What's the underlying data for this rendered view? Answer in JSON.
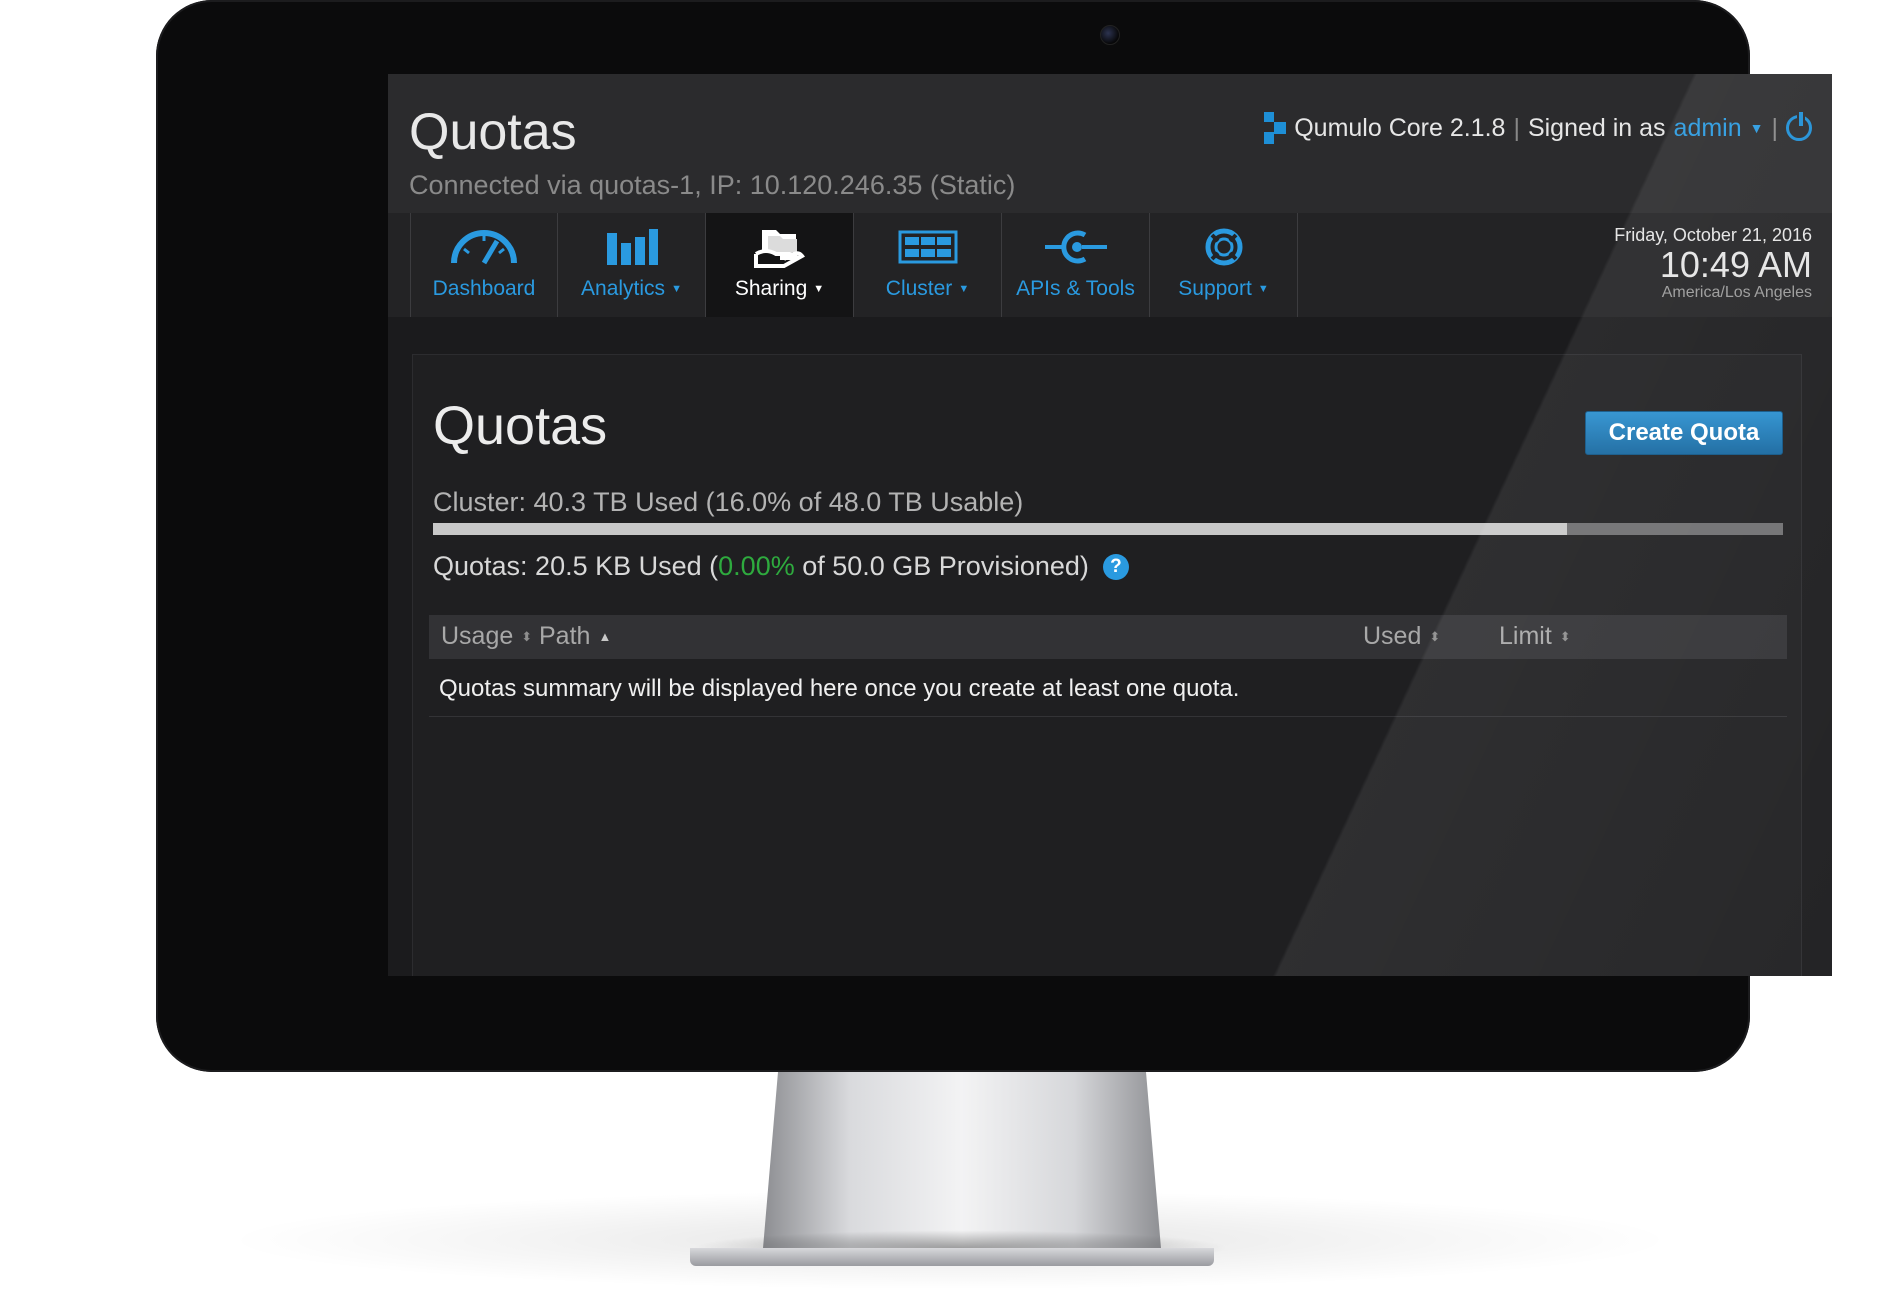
{
  "app": {
    "page_title": "Quotas",
    "connection": "Connected via quotas-1, IP: 10.120.246.35 (Static)",
    "product": "Qumulo Core 2.1.8",
    "signed_in_label": "Signed in as",
    "user": "admin",
    "separator": "|"
  },
  "nav": {
    "items": [
      {
        "label": "Dashboard",
        "icon": "speedometer-icon",
        "dropdown": false,
        "active": false
      },
      {
        "label": "Analytics",
        "icon": "bar-chart-icon",
        "dropdown": true,
        "active": false
      },
      {
        "label": "Sharing",
        "icon": "folders-hand-icon",
        "dropdown": true,
        "active": true
      },
      {
        "label": "Cluster",
        "icon": "server-rack-icon",
        "dropdown": true,
        "active": false
      },
      {
        "label": "APIs & Tools",
        "icon": "api-plug-icon",
        "dropdown": false,
        "active": false
      },
      {
        "label": "Support",
        "icon": "lifebuoy-icon",
        "dropdown": true,
        "active": false
      }
    ]
  },
  "datetime": {
    "date": "Friday, October 21, 2016",
    "time": "10:49 AM",
    "timezone": "America/Los Angeles"
  },
  "panel": {
    "title": "Quotas",
    "create_button": "Create Quota",
    "cluster_usage": "Cluster: 40.3 TB Used (16.0% of 48.0 TB Usable)",
    "cluster_bar_fraction": 0.84,
    "quotas_prefix": "Quotas: 20.5 KB Used (",
    "quotas_percent": "0.00%",
    "quotas_suffix": " of 50.0 GB Provisioned)",
    "help_label": "?",
    "table": {
      "columns": [
        "Usage",
        "Path",
        "Used",
        "Limit"
      ],
      "empty_message": "Quotas summary will be displayed here once you create at least one quota."
    }
  },
  "colors": {
    "accent": "#2a9ae0",
    "percent_green": "#2eaa3e",
    "button": "#1e7dbd"
  }
}
